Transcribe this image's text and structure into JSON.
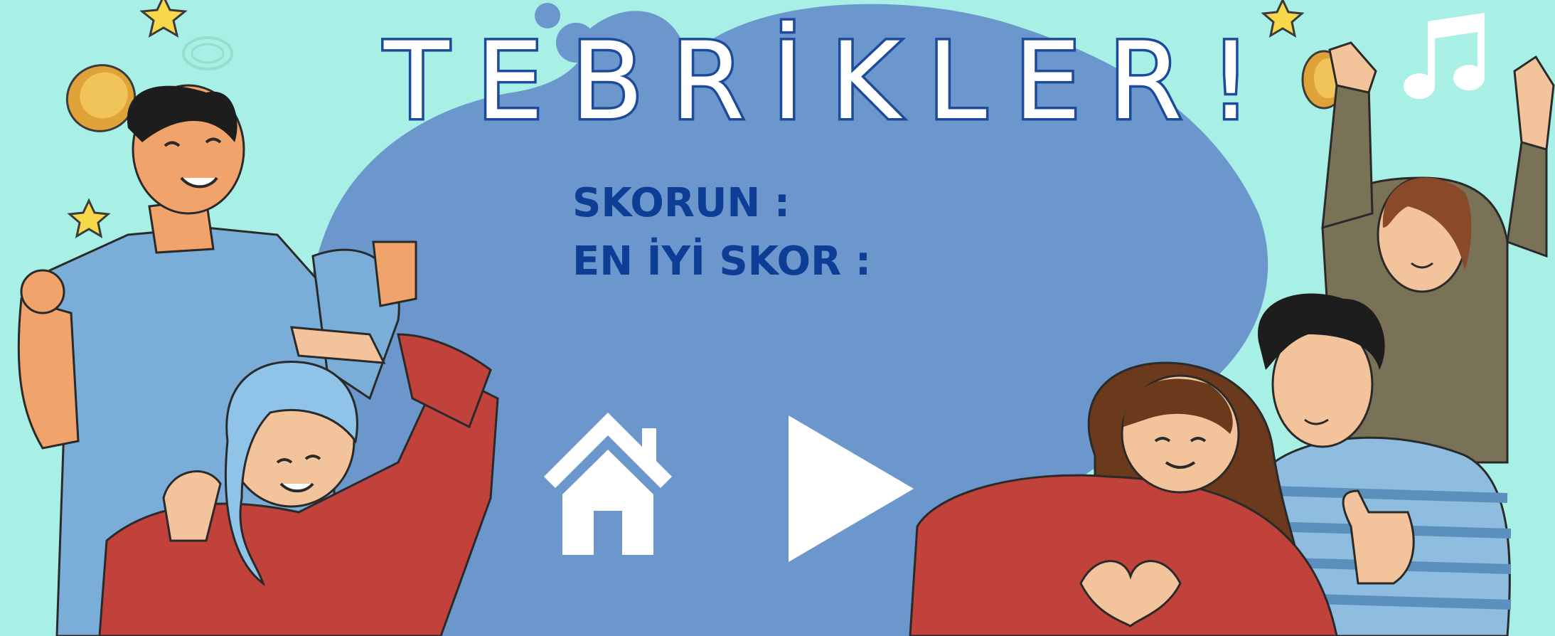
{
  "screen": {
    "title": "TEBRİKLER!",
    "score_label": "SKORUN :",
    "best_score_label": "EN İYİ SKOR :"
  },
  "buttons": {
    "home_icon": "home-icon",
    "play_icon": "play-icon"
  },
  "colors": {
    "background": "#a8efe6",
    "blob": "#6b97cc",
    "title_outline": "#1d4a9a",
    "label_text": "#0e3d96",
    "icon_fill": "#ffffff"
  }
}
